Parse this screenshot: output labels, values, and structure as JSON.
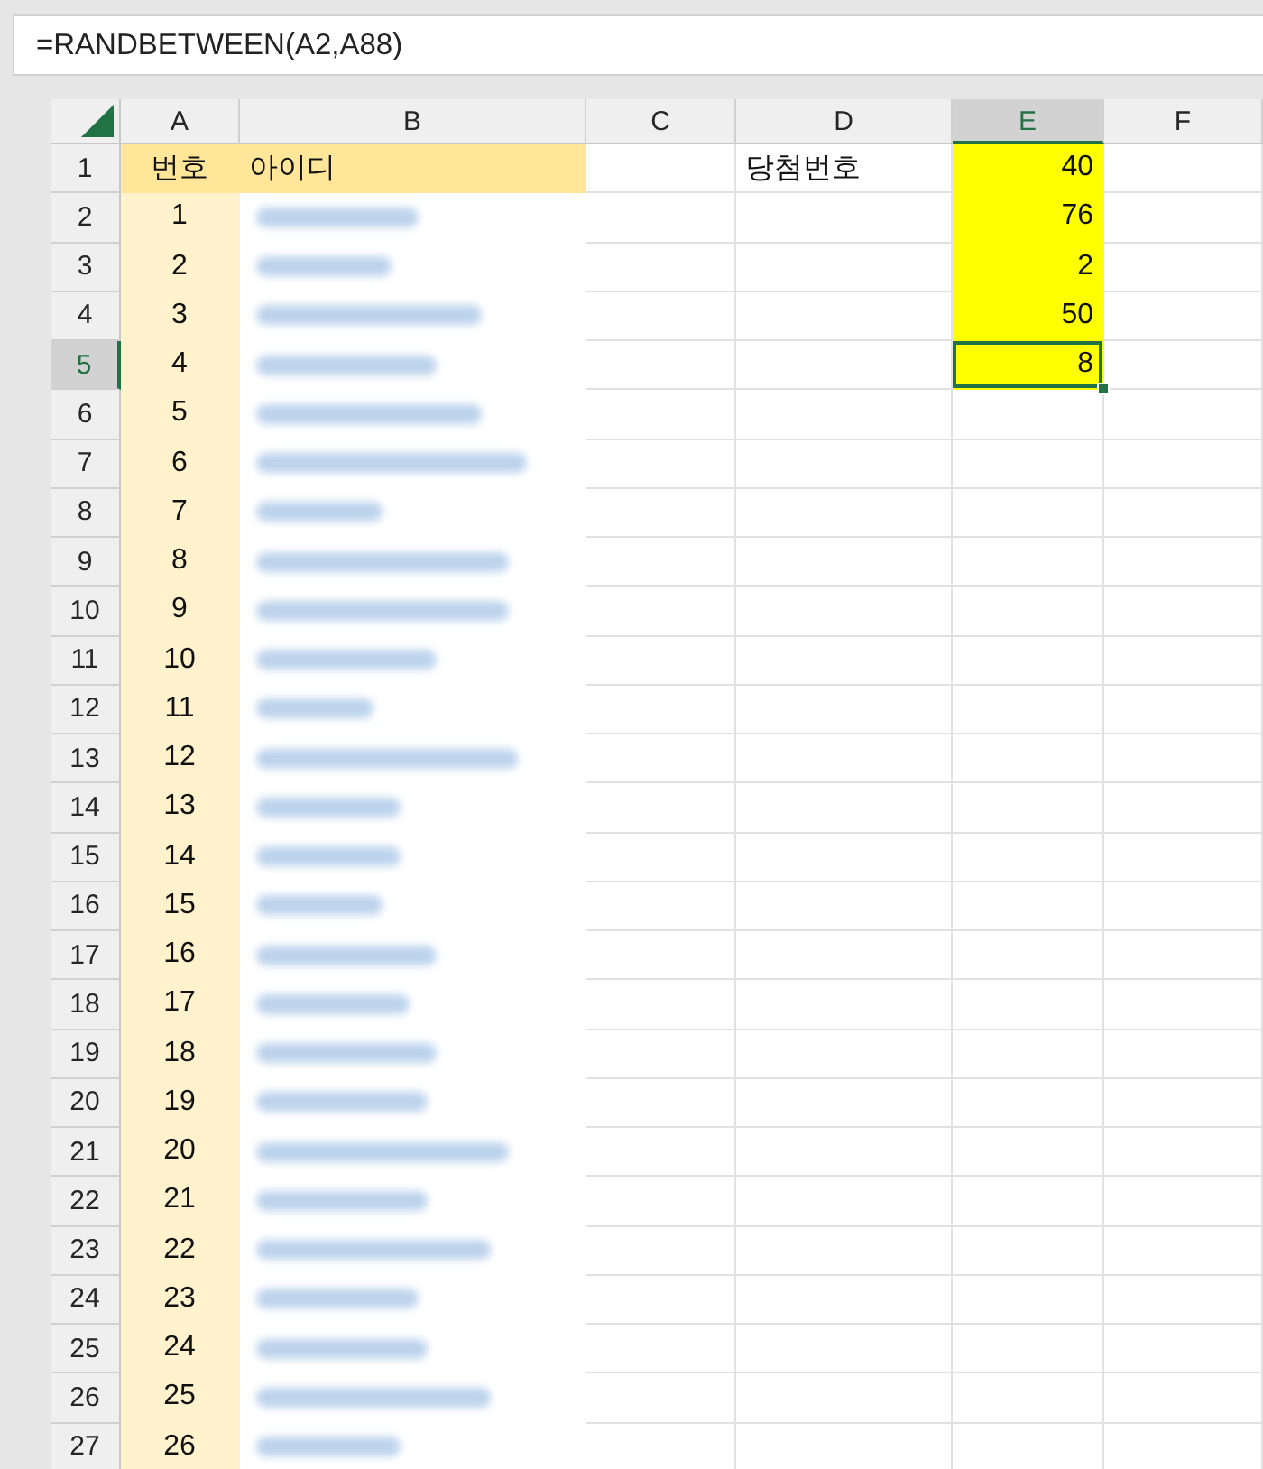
{
  "formula_bar": {
    "value": "=RANDBETWEEN(A2,A88)"
  },
  "sheet": {
    "columns": [
      {
        "label": "A",
        "selected": false
      },
      {
        "label": "B",
        "selected": false
      },
      {
        "label": "C",
        "selected": false
      },
      {
        "label": "D",
        "selected": false
      },
      {
        "label": "E",
        "selected": true
      },
      {
        "label": "F",
        "selected": false
      }
    ],
    "rows": [
      {
        "number": "1",
        "selected": false,
        "cells": [
          {
            "text": "번호",
            "color": "#ffe699",
            "selected": false
          },
          {
            "text": "아이디",
            "color": "#ffe699",
            "selected": false
          },
          {
            "selected": false
          },
          {
            "text": "당첨번호",
            "selected": false
          },
          {
            "text": "40",
            "color": "#ffff00",
            "selected": false
          },
          {
            "selected": false
          }
        ]
      },
      {
        "number": "2",
        "selected": false,
        "cells": [
          {
            "text": "1",
            "color": "#fff2cc",
            "selected": false
          },
          {
            "blurred": true,
            "selected": false
          },
          {
            "selected": false
          },
          {
            "selected": false
          },
          {
            "text": "76",
            "color": "#ffff00",
            "selected": false
          },
          {
            "selected": false
          }
        ]
      },
      {
        "number": "3",
        "selected": false,
        "cells": [
          {
            "text": "2",
            "color": "#fff2cc",
            "selected": false
          },
          {
            "blurred": true,
            "selected": false
          },
          {
            "selected": false
          },
          {
            "selected": false
          },
          {
            "text": "2",
            "color": "#ffff00",
            "selected": false
          },
          {
            "selected": false
          }
        ]
      },
      {
        "number": "4",
        "selected": false,
        "cells": [
          {
            "text": "3",
            "color": "#fff2cc",
            "selected": false
          },
          {
            "blurred": true,
            "selected": false
          },
          {
            "selected": false
          },
          {
            "selected": false
          },
          {
            "text": "50",
            "color": "#ffff00",
            "selected": false
          },
          {
            "selected": false
          }
        ]
      },
      {
        "number": "5",
        "selected": true,
        "cells": [
          {
            "text": "4",
            "color": "#fff2cc",
            "selected": false
          },
          {
            "blurred": true,
            "selected": false
          },
          {
            "selected": false
          },
          {
            "selected": false
          },
          {
            "text": "8",
            "color": "#ffff00",
            "selected": true
          },
          {
            "selected": false
          }
        ]
      },
      {
        "number": "6",
        "selected": false,
        "cells": [
          {
            "text": "5",
            "color": "#fff2cc",
            "selected": false
          },
          {
            "blurred": true,
            "selected": false
          },
          {
            "selected": false
          },
          {
            "selected": false
          },
          {
            "selected": false
          },
          {
            "selected": false
          }
        ]
      },
      {
        "number": "7",
        "selected": false,
        "cells": [
          {
            "text": "6",
            "color": "#fff2cc",
            "selected": false
          },
          {
            "blurred": true,
            "selected": false
          },
          {
            "selected": false
          },
          {
            "selected": false
          },
          {
            "selected": false
          },
          {
            "selected": false
          }
        ]
      },
      {
        "number": "8",
        "selected": false,
        "cells": [
          {
            "text": "7",
            "color": "#fff2cc",
            "selected": false
          },
          {
            "blurred": true,
            "selected": false
          },
          {
            "selected": false
          },
          {
            "selected": false
          },
          {
            "selected": false
          },
          {
            "selected": false
          }
        ]
      },
      {
        "number": "9",
        "selected": false,
        "cells": [
          {
            "text": "8",
            "color": "#fff2cc",
            "selected": false
          },
          {
            "blurred": true,
            "selected": false
          },
          {
            "selected": false
          },
          {
            "selected": false
          },
          {
            "selected": false
          },
          {
            "selected": false
          }
        ]
      },
      {
        "number": "10",
        "selected": false,
        "cells": [
          {
            "text": "9",
            "color": "#fff2cc",
            "selected": false
          },
          {
            "blurred": true,
            "selected": false
          },
          {
            "selected": false
          },
          {
            "selected": false
          },
          {
            "selected": false
          },
          {
            "selected": false
          }
        ]
      },
      {
        "number": "11",
        "selected": false,
        "cells": [
          {
            "text": "10",
            "color": "#fff2cc",
            "selected": false
          },
          {
            "blurred": true,
            "selected": false
          },
          {
            "selected": false
          },
          {
            "selected": false
          },
          {
            "selected": false
          },
          {
            "selected": false
          }
        ]
      },
      {
        "number": "12",
        "selected": false,
        "cells": [
          {
            "text": "11",
            "color": "#fff2cc",
            "selected": false
          },
          {
            "blurred": true,
            "selected": false
          },
          {
            "selected": false
          },
          {
            "selected": false
          },
          {
            "selected": false
          },
          {
            "selected": false
          }
        ]
      },
      {
        "number": "13",
        "selected": false,
        "cells": [
          {
            "text": "12",
            "color": "#fff2cc",
            "selected": false
          },
          {
            "blurred": true,
            "selected": false
          },
          {
            "selected": false
          },
          {
            "selected": false
          },
          {
            "selected": false
          },
          {
            "selected": false
          }
        ]
      },
      {
        "number": "14",
        "selected": false,
        "cells": [
          {
            "text": "13",
            "color": "#fff2cc",
            "selected": false
          },
          {
            "blurred": true,
            "selected": false
          },
          {
            "selected": false
          },
          {
            "selected": false
          },
          {
            "selected": false
          },
          {
            "selected": false
          }
        ]
      },
      {
        "number": "15",
        "selected": false,
        "cells": [
          {
            "text": "14",
            "color": "#fff2cc",
            "selected": false
          },
          {
            "blurred": true,
            "selected": false
          },
          {
            "selected": false
          },
          {
            "selected": false
          },
          {
            "selected": false
          },
          {
            "selected": false
          }
        ]
      },
      {
        "number": "16",
        "selected": false,
        "cells": [
          {
            "text": "15",
            "color": "#fff2cc",
            "selected": false
          },
          {
            "blurred": true,
            "selected": false
          },
          {
            "selected": false
          },
          {
            "selected": false
          },
          {
            "selected": false
          },
          {
            "selected": false
          }
        ]
      },
      {
        "number": "17",
        "selected": false,
        "cells": [
          {
            "text": "16",
            "color": "#fff2cc",
            "selected": false
          },
          {
            "blurred": true,
            "selected": false
          },
          {
            "selected": false
          },
          {
            "selected": false
          },
          {
            "selected": false
          },
          {
            "selected": false
          }
        ]
      },
      {
        "number": "18",
        "selected": false,
        "cells": [
          {
            "text": "17",
            "color": "#fff2cc",
            "selected": false
          },
          {
            "blurred": true,
            "selected": false
          },
          {
            "selected": false
          },
          {
            "selected": false
          },
          {
            "selected": false
          },
          {
            "selected": false
          }
        ]
      },
      {
        "number": "19",
        "selected": false,
        "cells": [
          {
            "text": "18",
            "color": "#fff2cc",
            "selected": false
          },
          {
            "blurred": true,
            "selected": false
          },
          {
            "selected": false
          },
          {
            "selected": false
          },
          {
            "selected": false
          },
          {
            "selected": false
          }
        ]
      },
      {
        "number": "20",
        "selected": false,
        "cells": [
          {
            "text": "19",
            "color": "#fff2cc",
            "selected": false
          },
          {
            "blurred": true,
            "selected": false
          },
          {
            "selected": false
          },
          {
            "selected": false
          },
          {
            "selected": false
          },
          {
            "selected": false
          }
        ]
      },
      {
        "number": "21",
        "selected": false,
        "cells": [
          {
            "text": "20",
            "color": "#fff2cc",
            "selected": false
          },
          {
            "blurred": true,
            "selected": false
          },
          {
            "selected": false
          },
          {
            "selected": false
          },
          {
            "selected": false
          },
          {
            "selected": false
          }
        ]
      },
      {
        "number": "22",
        "selected": false,
        "cells": [
          {
            "text": "21",
            "color": "#fff2cc",
            "selected": false
          },
          {
            "blurred": true,
            "selected": false
          },
          {
            "selected": false
          },
          {
            "selected": false
          },
          {
            "selected": false
          },
          {
            "selected": false
          }
        ]
      },
      {
        "number": "23",
        "selected": false,
        "cells": [
          {
            "text": "22",
            "color": "#fff2cc",
            "selected": false
          },
          {
            "blurred": true,
            "selected": false
          },
          {
            "selected": false
          },
          {
            "selected": false
          },
          {
            "selected": false
          },
          {
            "selected": false
          }
        ]
      },
      {
        "number": "24",
        "selected": false,
        "cells": [
          {
            "text": "23",
            "color": "#fff2cc",
            "selected": false
          },
          {
            "blurred": true,
            "selected": false
          },
          {
            "selected": false
          },
          {
            "selected": false
          },
          {
            "selected": false
          },
          {
            "selected": false
          }
        ]
      },
      {
        "number": "25",
        "selected": false,
        "cells": [
          {
            "text": "24",
            "color": "#fff2cc",
            "selected": false
          },
          {
            "blurred": true,
            "selected": false
          },
          {
            "selected": false
          },
          {
            "selected": false
          },
          {
            "selected": false
          },
          {
            "selected": false
          }
        ]
      },
      {
        "number": "26",
        "selected": false,
        "cells": [
          {
            "text": "25",
            "color": "#fff2cc",
            "selected": false
          },
          {
            "blurred": true,
            "selected": false
          },
          {
            "selected": false
          },
          {
            "selected": false
          },
          {
            "selected": false
          },
          {
            "selected": false
          }
        ]
      },
      {
        "number": "27",
        "selected": false,
        "cells": [
          {
            "text": "26",
            "color": "#fff2cc",
            "selected": false
          },
          {
            "blurred": true,
            "selected": false
          },
          {
            "selected": false
          },
          {
            "selected": false
          },
          {
            "selected": false
          },
          {
            "selected": false
          }
        ]
      }
    ]
  }
}
